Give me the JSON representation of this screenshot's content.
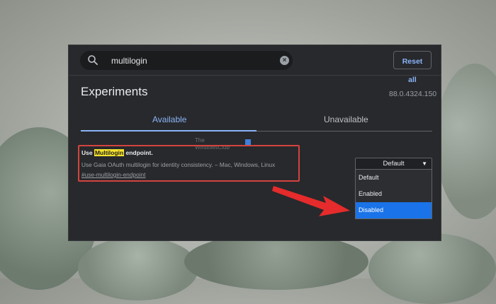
{
  "search": {
    "query": "multilogin"
  },
  "header": {
    "reset_label": "Reset all"
  },
  "page": {
    "title": "Experiments",
    "version": "88.0.4324.150"
  },
  "tabs": [
    {
      "label": "Available",
      "active": true
    },
    {
      "label": "Unavailable",
      "active": false
    }
  ],
  "flag": {
    "name_prefix": "Use ",
    "name_highlight": "Multilogin",
    "name_suffix": " endpoint.",
    "description": "Use Gaia OAuth multilogin for identity consistency. – Mac, Windows, Linux",
    "link": "#use-multilogin-endpoint"
  },
  "select": {
    "value": "Default",
    "options": [
      "Default",
      "Enabled",
      "Disabled"
    ],
    "highlighted": "Disabled"
  },
  "watermark": {
    "line1": "The",
    "line2": "WindowsClub"
  },
  "colors": {
    "accent": "#8ab4f8",
    "highlight": "#f5e32f",
    "annotation_red": "#d4433e",
    "selected_option": "#1a73e8"
  },
  "icons": {
    "search": "search-icon",
    "clear": "clear-icon",
    "dropdown": "chevron-down-icon",
    "annotation": "red-arrow"
  }
}
